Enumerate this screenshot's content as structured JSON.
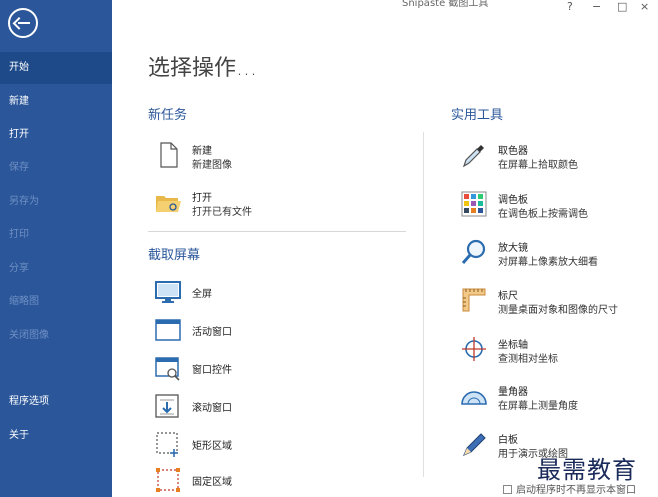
{
  "window": {
    "title": "Snipaste 截图工具"
  },
  "sidebar": {
    "items": [
      {
        "label": "开始",
        "state": "active"
      },
      {
        "label": "新建",
        "state": "enabled"
      },
      {
        "label": "打开",
        "state": "enabled"
      },
      {
        "label": "保存",
        "state": "disabled"
      },
      {
        "label": "另存为",
        "state": "disabled"
      },
      {
        "label": "打印",
        "state": "disabled"
      },
      {
        "label": "分享",
        "state": "disabled"
      },
      {
        "label": "缩略图",
        "state": "disabled"
      },
      {
        "label": "关闭图像",
        "state": "disabled"
      },
      {
        "label": "程序选项",
        "state": "enabled"
      },
      {
        "label": "关于",
        "state": "enabled"
      }
    ]
  },
  "main": {
    "heading": "选择操作...",
    "new_task": {
      "title": "新任务",
      "items": [
        {
          "name": "新建",
          "desc": "新建图像",
          "icon": "blank-document-icon"
        },
        {
          "name": "打开",
          "desc": "打开已有文件",
          "icon": "folder-open-icon"
        }
      ]
    },
    "capture": {
      "title": "截取屏幕",
      "items": [
        {
          "label": "全屏",
          "icon": "monitor-icon"
        },
        {
          "label": "活动窗口",
          "icon": "window-icon"
        },
        {
          "label": "窗口控件",
          "icon": "window-control-icon"
        },
        {
          "label": "滚动窗口",
          "icon": "scroll-window-icon"
        },
        {
          "label": "矩形区域",
          "icon": "rectangle-selection-icon"
        },
        {
          "label": "固定区域",
          "icon": "fixed-region-icon"
        }
      ]
    },
    "tools": {
      "title": "实用工具",
      "items": [
        {
          "name": "取色器",
          "desc": "在屏幕上拾取颜色",
          "icon": "eyedropper-icon"
        },
        {
          "name": "调色板",
          "desc": "在调色板上按需调色",
          "icon": "palette-icon"
        },
        {
          "name": "放大镜",
          "desc": "对屏幕上像素放大细看",
          "icon": "magnifier-icon"
        },
        {
          "name": "标尺",
          "desc": "测量桌面对象和图像的尺寸",
          "icon": "ruler-icon"
        },
        {
          "name": "坐标轴",
          "desc": "查测相对坐标",
          "icon": "crosshair-icon"
        },
        {
          "name": "量角器",
          "desc": "在屏幕上测量角度",
          "icon": "protractor-icon"
        },
        {
          "name": "白板",
          "desc": "用于演示或绘图",
          "icon": "pen-icon"
        }
      ]
    },
    "startup_checkbox": {
      "label": "启动程序时不再显示本窗口",
      "checked": false
    }
  },
  "watermark": "最需教育",
  "colors": {
    "sidebar": "#2b579a",
    "accent": "#2b579a"
  }
}
